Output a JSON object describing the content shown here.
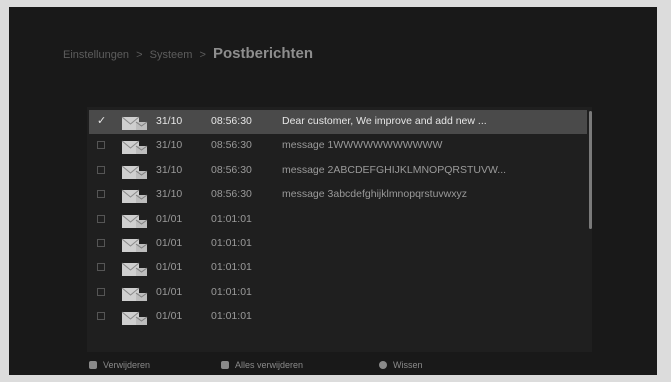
{
  "breadcrumb": {
    "items": [
      "Einstellungen",
      "Systeem"
    ],
    "separator": ">",
    "current": "Postberichten"
  },
  "messages": [
    {
      "checked": true,
      "date": "31/10",
      "time": "08:56:30",
      "text": "Dear customer,  We improve and add new ..."
    },
    {
      "checked": false,
      "date": "31/10",
      "time": "08:56:30",
      "text": "message 1WWWWWWWWWWW"
    },
    {
      "checked": false,
      "date": "31/10",
      "time": "08:56:30",
      "text": "message 2ABCDEFGHIJKLMNOPQRSTUVW..."
    },
    {
      "checked": false,
      "date": "31/10",
      "time": "08:56:30",
      "text": "message 3abcdefghijklmnopqrstuvwxyz"
    },
    {
      "checked": false,
      "date": "01/01",
      "time": "01:01:01",
      "text": ""
    },
    {
      "checked": false,
      "date": "01/01",
      "time": "01:01:01",
      "text": ""
    },
    {
      "checked": false,
      "date": "01/01",
      "time": "01:01:01",
      "text": ""
    },
    {
      "checked": false,
      "date": "01/01",
      "time": "01:01:01",
      "text": ""
    },
    {
      "checked": false,
      "date": "01/01",
      "time": "01:01:01",
      "text": ""
    }
  ],
  "check_glyph": "✓",
  "footer": {
    "delete_label": "Verwijderen",
    "delete_all_label": "Alles verwijderen",
    "exit_label": "Wissen"
  },
  "colors": {
    "background": "#191919",
    "selected_row": "#4a4a4a",
    "text": "#9a9a9a"
  },
  "icons": {
    "row": "mail-envelope-icon"
  }
}
